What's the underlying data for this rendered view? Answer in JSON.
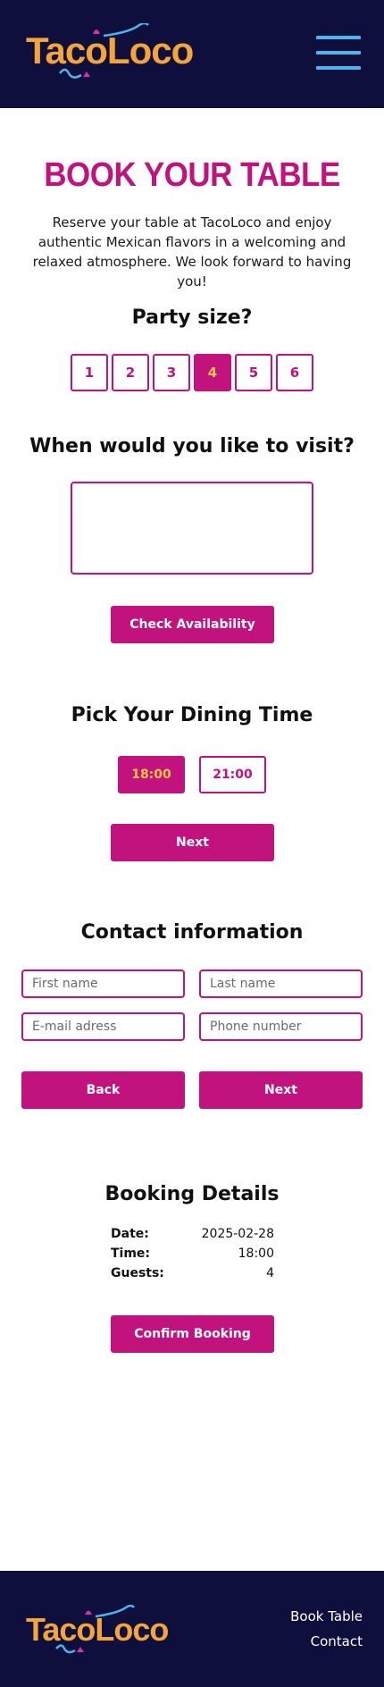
{
  "brand": {
    "name_part1": "Taco",
    "name_part2": "Loco"
  },
  "header": {
    "menu_icon": "hamburger-menu-icon"
  },
  "page": {
    "title": "BOOK YOUR TABLE",
    "intro": "Reserve your table at TacoLoco and enjoy authentic Mexican flavors in a welcoming and relaxed atmosphere. We look forward to having you!"
  },
  "party": {
    "heading": "Party size?",
    "sizes": [
      "1",
      "2",
      "3",
      "4",
      "5",
      "6"
    ],
    "selected": "4"
  },
  "visit": {
    "heading": "When would you like to visit?",
    "check_label": "Check Availability"
  },
  "dining": {
    "heading": "Pick Your Dining Time",
    "times": [
      "18:00",
      "21:00"
    ],
    "selected": "18:00",
    "next_label": "Next"
  },
  "contact": {
    "heading": "Contact information",
    "first_name_placeholder": "First name",
    "last_name_placeholder": "Last name",
    "email_placeholder": "E-mail adress",
    "phone_placeholder": "Phone number",
    "back_label": "Back",
    "next_label": "Next"
  },
  "booking": {
    "heading": "Booking Details",
    "date_label": "Date:",
    "date_value": "2025-02-28",
    "time_label": "Time:",
    "time_value": "18:00",
    "guests_label": "Guests:",
    "guests_value": "4",
    "confirm_label": "Confirm Booking"
  },
  "footer": {
    "links": [
      "Book Table",
      "Contact"
    ]
  },
  "colors": {
    "navy": "#0f0f3e",
    "magenta": "#c1127e",
    "gold": "#f3a53a",
    "yellow": "#f6c944",
    "sky": "#4fb3ee"
  }
}
